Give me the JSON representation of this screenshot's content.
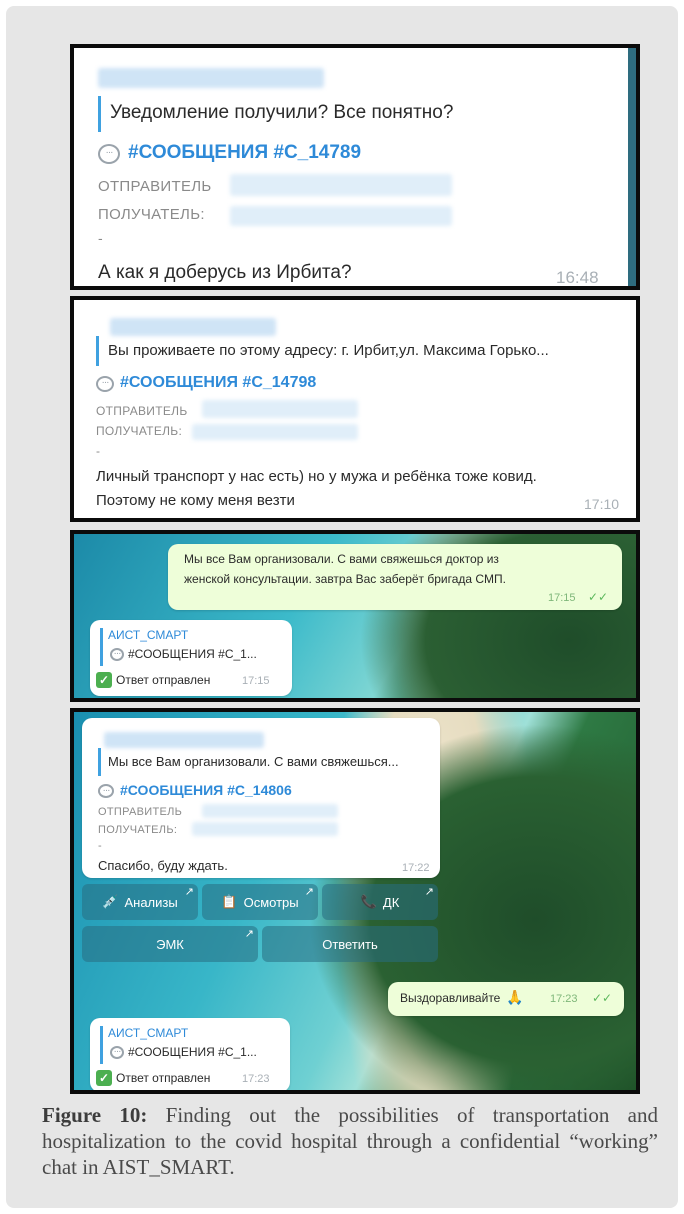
{
  "panel1": {
    "quote_text": "Уведомление получили? Все понятно?",
    "tag": "#СООБЩЕНИЯ #С_14789",
    "sender_label": "ОТПРАВИТЕЛЬ",
    "recipient_label": "ПОЛУЧАТЕЛЬ:",
    "dash": "-",
    "message": "А как я доберусь из Ирбита?",
    "time": "16:48"
  },
  "panel2": {
    "quote_text": "Вы проживаете по этому адресу: г. Ирбит,ул. Максима Горько...",
    "tag": "#СООБЩЕНИЯ #С_14798",
    "sender_label": "ОТПРАВИТЕЛЬ",
    "recipient_label": "ПОЛУЧАТЕЛЬ:",
    "dash": "-",
    "message_line1": "Личный транспорт у нас есть) но у мужа и ребёнка тоже ковид.",
    "message_line2": "Поэтому не кому меня везти",
    "time": "17:10"
  },
  "panel3": {
    "outgoing_line1": "Мы все Вам организовали. С вами свяжешься доктор из",
    "outgoing_line2": "женской консультации. завтра Вас заберёт бригада СМП.",
    "outgoing_time": "17:15",
    "bot_name": "АИСТ_СМАРТ",
    "bot_tag": "#СООБЩЕНИЯ #С_1...",
    "bot_status": "Ответ отправлен",
    "bot_time": "17:15"
  },
  "panel4": {
    "quote_text": "Мы все Вам организовали. С вами свяжешься...",
    "tag": "#СООБЩЕНИЯ #С_14806",
    "sender_label": "ОТПРАВИТЕЛЬ",
    "recipient_label": "ПОЛУЧАТЕЛЬ:",
    "dash": "-",
    "message": "Спасибо, буду ждать.",
    "time": "17:22",
    "buttons": {
      "analyses": "Анализы",
      "exams": "Осмотры",
      "dk": "ДК",
      "emk": "ЭМК",
      "reply": "Ответить"
    },
    "outgoing": "Выздоравливайте",
    "outgoing_emoji": "🙏",
    "outgoing_time": "17:23",
    "bot_name": "АИСТ_СМАРТ",
    "bot_tag": "#СООБЩЕНИЯ #С_1...",
    "bot_status": "Ответ отправлен",
    "bot_time": "17:23"
  },
  "caption": {
    "label": "Figure 10:",
    "text": "Finding out the possibilities of transportation and hospitalization to the covid hospital through a confidential “working” chat in AIST_SMART."
  },
  "colors": {
    "tag_blue": "#2e8ad8",
    "quote_bar": "#3fa1e0",
    "panel_border": "#0b0b0b",
    "outgoing_bubble": "#eefed9",
    "check_green": "#4caf50"
  }
}
